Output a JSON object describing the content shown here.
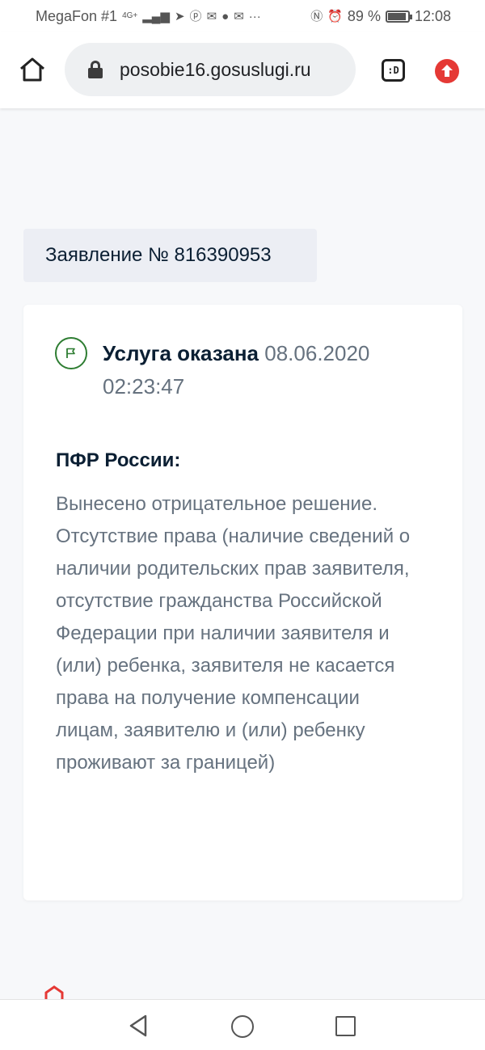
{
  "status_bar": {
    "carrier": "MegaFon #1",
    "network": "4G+",
    "battery": "89 %",
    "time": "12:08"
  },
  "browser": {
    "url": "posobie16.gosuslugi.ru",
    "tab_label": ":D"
  },
  "application": {
    "label": "Заявление № 816390953"
  },
  "card": {
    "status_title": "Услуга оказана",
    "status_date": "08.06.2020 02:23:47",
    "org": "ПФР России:",
    "decision": "Вынесено отрицательное решение. Отсутствие права (наличие сведений о наличии родительских прав заявителя, отсутствие гражданства Российской Федерации при наличии заявителя и (или) ребенка, заявителя не касается права на получение компенсации лицам, заявителю и (или) ребенку проживают за границей)"
  },
  "colors": {
    "status_green": "#2e7d32",
    "upload_red": "#e53935",
    "muted_text": "#66727f"
  }
}
